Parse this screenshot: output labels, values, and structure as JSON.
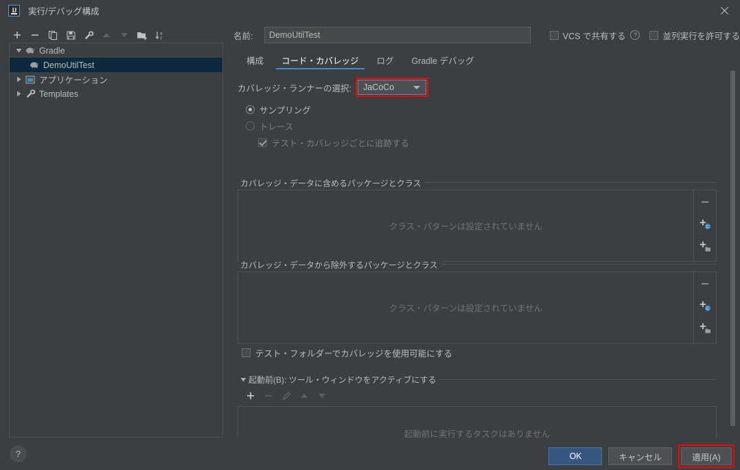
{
  "window": {
    "title": "実行/デバッグ構成",
    "logo_text": "IJ",
    "close_icon": "close-icon"
  },
  "tree_toolbar": {
    "items": [
      {
        "name": "add-configuration-button",
        "icon": "plus-icon",
        "enabled": true
      },
      {
        "name": "remove-configuration-button",
        "icon": "minus-icon",
        "enabled": true
      },
      {
        "name": "copy-configuration-button",
        "icon": "copy-icon",
        "enabled": true
      },
      {
        "name": "save-configuration-button",
        "icon": "save-icon",
        "enabled": true
      },
      {
        "name": "edit-templates-button",
        "icon": "wrench-icon",
        "enabled": true
      },
      {
        "name": "move-up-button",
        "icon": "arrow-up-icon",
        "enabled": false
      },
      {
        "name": "move-down-button",
        "icon": "arrow-down-icon",
        "enabled": false
      },
      {
        "name": "create-folder-button",
        "icon": "folder-add-icon",
        "enabled": true
      },
      {
        "name": "sort-configurations-button",
        "icon": "sort-az-icon",
        "enabled": true
      }
    ]
  },
  "tree": {
    "nodes": [
      {
        "label": "Gradle",
        "icon": "gradle-elephant-icon",
        "expanded": true,
        "level": 0,
        "selected": false,
        "has_twisty": true
      },
      {
        "label": "DemoUtilTest",
        "icon": "gradle-elephant-icon",
        "expanded": false,
        "level": 1,
        "selected": true,
        "has_twisty": false
      },
      {
        "label": "アプリケーション",
        "icon": "application-icon",
        "expanded": false,
        "level": 0,
        "selected": false,
        "has_twisty": true
      },
      {
        "label": "Templates",
        "icon": "wrench-icon",
        "expanded": false,
        "level": 0,
        "selected": false,
        "has_twisty": true
      }
    ]
  },
  "name_row": {
    "label": "名前:",
    "value": "DemoUtilTest",
    "placeholder": "",
    "share_checkbox": {
      "label": "VCS で共有する",
      "checked": false
    },
    "help_icon_glyph": "?",
    "parallel_checkbox": {
      "label": "並列実行を許可する",
      "checked": false
    }
  },
  "tabs": [
    {
      "label": "構成",
      "active": false
    },
    {
      "label": "コード・カバレッジ",
      "active": true
    },
    {
      "label": "ログ",
      "active": false
    },
    {
      "label": "Gradle デバッグ",
      "active": false
    }
  ],
  "coverage": {
    "runner_label": "カバレッジ・ランナーの選択:",
    "runner_value": "JaCoCo",
    "runner_highlight_color": "#ff0000",
    "runner_options": [
      "JaCoCo"
    ],
    "sampling_radio": {
      "label": "サンプリング",
      "checked": true,
      "enabled": true
    },
    "trace_radio": {
      "label": "トレース",
      "checked": false,
      "enabled": false
    },
    "track_per_test_checkbox": {
      "label": "テスト・カバレッジごとに追跡する",
      "checked": true,
      "enabled": false
    },
    "include_group": {
      "title": "カバレッジ・データに含めるパッケージとクラス",
      "empty_text": "クラス・パターンは設定されていません",
      "buttons": [
        {
          "name": "remove-pattern-button",
          "icon": "minus-icon"
        },
        {
          "name": "add-class-pattern-button",
          "icon": "add-class-icon"
        },
        {
          "name": "add-package-pattern-button",
          "icon": "add-package-icon"
        }
      ]
    },
    "exclude_group": {
      "title": "カバレッジ・データから除外するパッケージとクラス",
      "empty_text": "クラス・パターンは設定されていません",
      "buttons": [
        {
          "name": "remove-pattern-button",
          "icon": "minus-icon"
        },
        {
          "name": "add-class-pattern-button",
          "icon": "add-class-icon"
        },
        {
          "name": "add-package-pattern-button",
          "icon": "add-package-icon"
        }
      ]
    },
    "test_folders_checkbox": {
      "label": "テスト・フォルダーでカバレッジを使用可能にする",
      "checked": false,
      "enabled": true
    }
  },
  "before_launch": {
    "title": "起動前(B): ツール・ウィンドウをアクティブにする",
    "expanded": true,
    "toolbar": [
      {
        "name": "add-task-button",
        "icon": "plus-icon",
        "enabled": true
      },
      {
        "name": "remove-task-button",
        "icon": "minus-icon",
        "enabled": false
      },
      {
        "name": "edit-task-button",
        "icon": "pencil-icon",
        "enabled": false
      },
      {
        "name": "task-move-up-button",
        "icon": "arrow-up-icon",
        "enabled": false
      },
      {
        "name": "task-move-down-button",
        "icon": "arrow-down-icon",
        "enabled": false
      }
    ],
    "empty_text": "起動前に実行するタスクはありません"
  },
  "footer": {
    "help_glyph": "?",
    "ok_label": "OK",
    "cancel_label": "キャンセル",
    "apply_label": "適用(A)",
    "apply_highlight_color": "#ff0000"
  },
  "colors": {
    "window_bg": "#3c3f41",
    "selection_bg": "#0d293e",
    "primary_button_bg": "#365880",
    "tab_underline": "#4a88c7",
    "highlight_red": "#ff0000"
  }
}
